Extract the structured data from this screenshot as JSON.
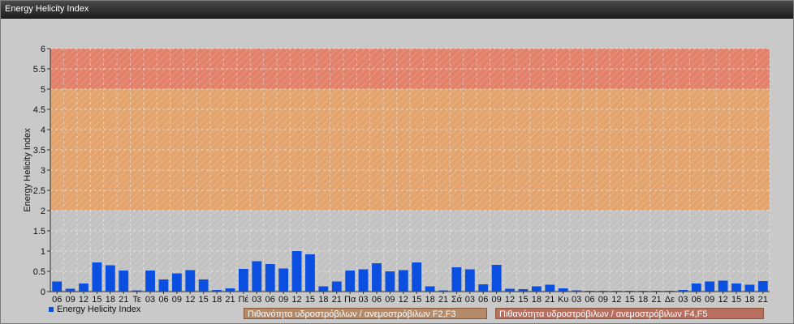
{
  "window": {
    "title": "Energy Helicity Index"
  },
  "chart_data": {
    "type": "bar",
    "title": "",
    "ylabel": "Energy Helicity Index",
    "xlabel": "",
    "ylim": [
      0,
      6
    ],
    "yticks": [
      "0",
      "0.5",
      "1",
      "1.5",
      "2",
      "2.5",
      "3",
      "3.5",
      "4",
      "4.5",
      "5",
      "5.5",
      "6"
    ],
    "bands": [
      {
        "from": 2,
        "to": 5,
        "color": "#e3a36c",
        "label": "Πιθανότητα υδροστρόβιλων / ανεμοστρόβιλων F2,F3"
      },
      {
        "from": 5,
        "to": 6,
        "color": "#e2806a",
        "label": "Πιθανότητα υδροστρόβιλων / ανεμοστρόβιλων F4,F5"
      }
    ],
    "categories": [
      "06",
      "09",
      "12",
      "15",
      "18",
      "21",
      "Τε",
      "03",
      "06",
      "09",
      "12",
      "15",
      "18",
      "21",
      "Πέ",
      "03",
      "06",
      "09",
      "12",
      "15",
      "18",
      "21",
      "Πα",
      "03",
      "06",
      "09",
      "12",
      "15",
      "18",
      "21",
      "Σά",
      "03",
      "06",
      "09",
      "12",
      "15",
      "18",
      "21",
      "Κυ",
      "03",
      "06",
      "09",
      "12",
      "15",
      "18",
      "21",
      "Δε",
      "03",
      "06",
      "09",
      "12",
      "15",
      "18",
      "21"
    ],
    "series": [
      {
        "name": "Energy Helicity Index",
        "color": "#0a4fe0",
        "values": [
          0.25,
          0.07,
          0.2,
          0.72,
          0.65,
          0.52,
          0.03,
          0.52,
          0.3,
          0.45,
          0.53,
          0.3,
          0.04,
          0.08,
          0.56,
          0.75,
          0.68,
          0.57,
          1.0,
          0.92,
          0.13,
          0.25,
          0.52,
          0.55,
          0.7,
          0.5,
          0.53,
          0.72,
          0.13,
          0.03,
          0.6,
          0.55,
          0.18,
          0.66,
          0.07,
          0.06,
          0.13,
          0.17,
          0.08,
          0.03,
          0.02,
          0.02,
          0.02,
          0.02,
          0.02,
          0.02,
          0.02,
          0.04,
          0.2,
          0.25,
          0.27,
          0.2,
          0.17,
          0.26
        ]
      }
    ],
    "legend": "bottom-left"
  }
}
